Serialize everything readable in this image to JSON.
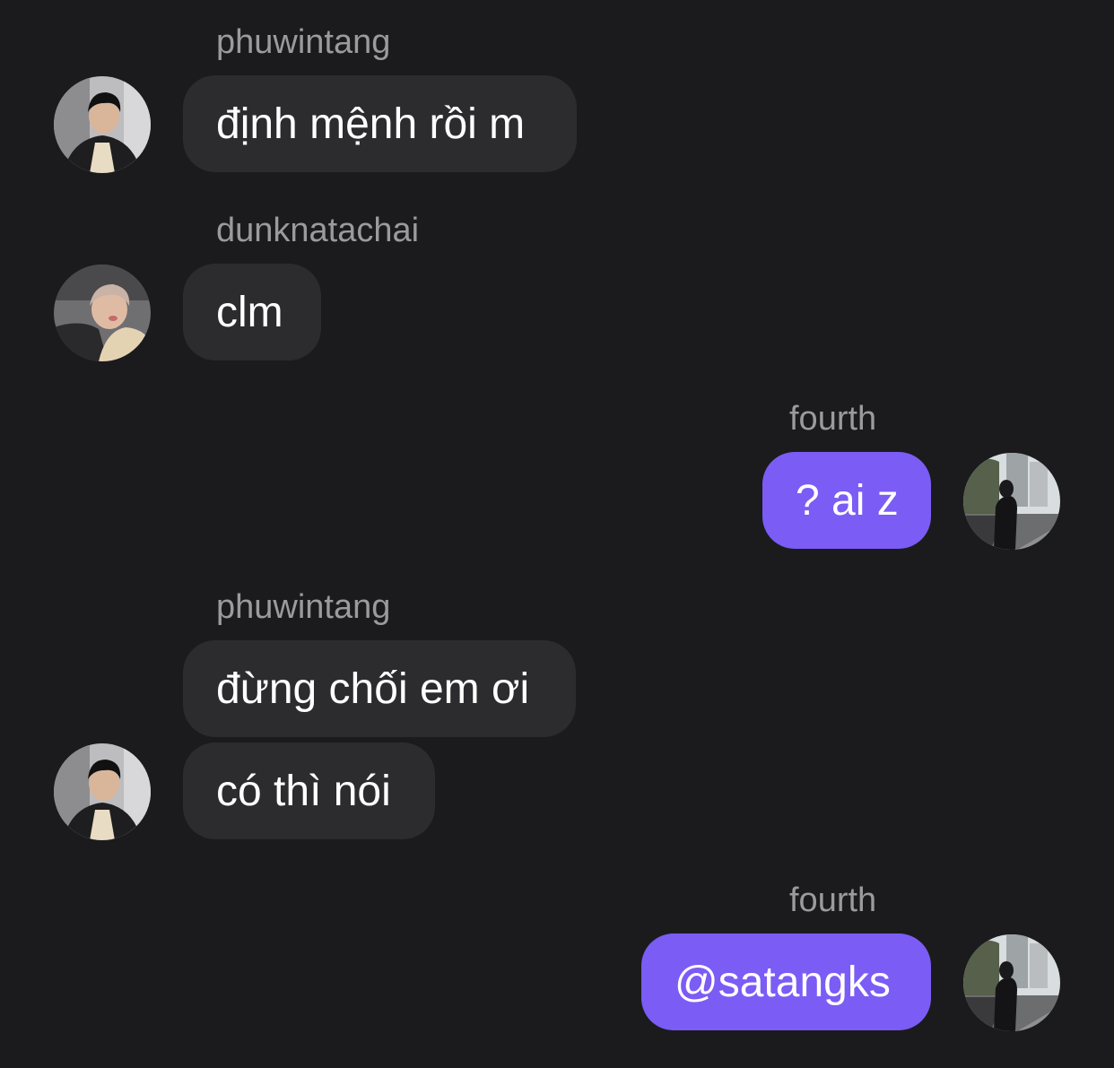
{
  "messages": [
    {
      "sender": "phuwintang",
      "avatar_icon": "avatar-phuwintang-icon",
      "bubbles": [
        "định mệnh rồi m"
      ]
    },
    {
      "sender": "dunknatachai",
      "avatar_icon": "avatar-dunknatachai-icon",
      "bubbles": [
        "clm"
      ]
    },
    {
      "sender": "fourth",
      "avatar_icon": "avatar-fourth-icon",
      "bubbles": [
        "? ai z"
      ]
    },
    {
      "sender": "phuwintang",
      "avatar_icon": "avatar-phuwintang-icon",
      "bubbles": [
        "đừng chối em ơi",
        "có thì nói"
      ]
    },
    {
      "sender": "fourth",
      "avatar_icon": "avatar-fourth-icon",
      "bubbles": [
        "@satangks"
      ]
    }
  ],
  "colors": {
    "background": "#1b1b1d",
    "incoming_bubble": "#2c2c2f",
    "outgoing_bubble": "#7b5cf5",
    "sender_name": "#9a9a9f",
    "message_text": "#ffffff"
  }
}
